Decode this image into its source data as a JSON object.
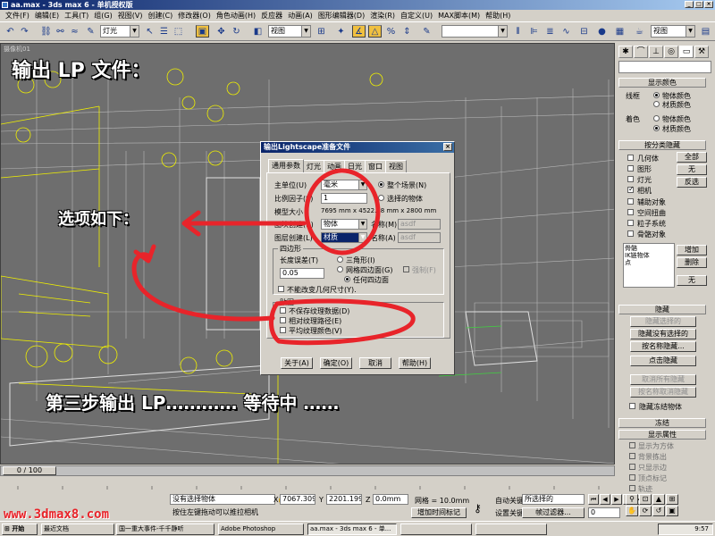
{
  "window": {
    "title": "aa.max - 3ds max 6 - 单机授权版"
  },
  "menu": [
    "文件(F)",
    "编辑(E)",
    "工具(T)",
    "组(G)",
    "视图(V)",
    "创建(C)",
    "修改器(O)",
    "角色(H)",
    "reactor",
    "动画(A)",
    "图形编辑器(D)",
    "渲染(R)",
    "自定义(U)",
    "MAXScript(M)",
    "帮助(H)"
  ],
  "menu_display": [
    "文件(F)",
    "编辑(E)",
    "工具(T)",
    "组(G)",
    "视图(V)",
    "创建(C)",
    "修改器(O)",
    "角色动画(H)",
    "反应器",
    "动画(A)",
    "图形编辑器(D)",
    "渲染(R)",
    "自定义(U)",
    "MAX脚本(M)",
    "帮助(H)"
  ],
  "toolbar": {
    "selection_filter": "灯光",
    "ref_coord": "视图",
    "named_selection": "",
    "render_view": "视图"
  },
  "viewport": {
    "label": "摄像机01"
  },
  "annotations": {
    "step_title": "输出 LP 文件：",
    "options_note": "选项如下：",
    "step3": "第三步输出 LP………… 等待中 ……"
  },
  "dialog": {
    "title": "输出Lightscape准备文件",
    "tabs": [
      "通用参数",
      "灯光",
      "动画",
      "日光",
      "窗口",
      "视图"
    ],
    "main_unit_label": "主单位(U)",
    "main_unit_value": "毫米",
    "scale_label": "比例因子(S)",
    "scale_value": "1",
    "model_size_label": "模型大小",
    "model_size_value": "7695 mm x 4522.38 mm x 2800 mm",
    "scope_all": "整个场景(N)",
    "scope_selected": "选择的物体",
    "block_create_label": "图块创建(B)",
    "block_create_value": "物体",
    "block_name_label": "名称(M)",
    "block_name_value": "asdf",
    "layer_create_label": "图层创建(L)",
    "layer_create_value": "材质",
    "layer_name_label": "名称(A)",
    "layer_name_value": "asdf",
    "quad_group": "四边形",
    "length_tol_label": "长度误差(T)",
    "length_tol_value": "0.05",
    "opt_triangle": "三角形(I)",
    "opt_mesh_quad": "网格四边面(G)",
    "opt_force": "强制(F)",
    "opt_any_quad": "任何四边面",
    "no_change_geom": "不能改变几何尺寸(Y).",
    "texture_group": "贴图",
    "no_save_texture": "不保存纹理数据(D)",
    "relative_texture_path": "相对纹理路径(E)",
    "average_texture_color": "平均纹理颜色(V)",
    "btn_about": "关于(A)",
    "btn_ok": "确定(O)",
    "btn_cancel": "取消",
    "btn_help": "帮助(H)"
  },
  "command_panel": {
    "name_field": "",
    "display_color": "显示颜色",
    "wireframe_label": "线框",
    "shaded_label": "着色",
    "object_color": "物体颜色",
    "material_color": "材质颜色",
    "hide_by_category": "按分类隐藏",
    "categories": [
      "几何体",
      "图形",
      "灯光",
      "相机",
      "辅助对象",
      "空间扭曲",
      "粒子系统",
      "骨骼对象"
    ],
    "btn_all": "全部",
    "btn_none": "无",
    "btn_invert": "反选",
    "list_items": [
      "骨骼",
      "IK链物体",
      "点"
    ],
    "btn_add": "增加",
    "btn_remove": "删除",
    "btn_none2": "无",
    "hide": "隐藏",
    "hide_selected": "隐藏选择的",
    "hide_unselected": "隐藏没有选择的",
    "hide_by_name": "按名称隐藏...",
    "hide_by_hit": "点击隐藏",
    "unhide_all": "取消所有隐藏",
    "unhide_by_name": "按名称取消隐藏",
    "hide_frozen": "隐藏冻结物体",
    "freeze": "冻结",
    "display_props": "显示属性",
    "props": [
      "显示为方体",
      "背景拣出",
      "只显示边",
      "顶点标记",
      "轨迹"
    ]
  },
  "bottom": {
    "frame_counter": "0 / 100",
    "status_selection": "没有选择物体",
    "status_prompt": "按住左键拖动可以推拉相机",
    "x_label": "X",
    "x_value": "7067.309",
    "y_label": "Y",
    "y_value": "2201.199",
    "z_label": "Z",
    "z_value": "0.0mm",
    "grid_label": "网格 = 10.0mm",
    "add_time_tag": "增加时间标记",
    "auto_key": "自动关键点",
    "set_key": "设置关键点",
    "selection_set": "所选择的",
    "key_filters": "帧过滤器...",
    "frame_field": "0"
  },
  "taskbar": {
    "start": "开始",
    "tasks": [
      "最近文档",
      "国一重大事件-千千静听",
      "Adobe Photoshop",
      "aa.max - 3ds max 6 - 单...",
      "",
      ""
    ],
    "clock": "9:57"
  },
  "watermark": "www.3dmax8.com",
  "colors": {
    "annotation_red": "#e8242a",
    "wire_yellow": "#f0f000",
    "viewport_bg": "#6e6e6e",
    "title_blue": "#0a246a"
  }
}
